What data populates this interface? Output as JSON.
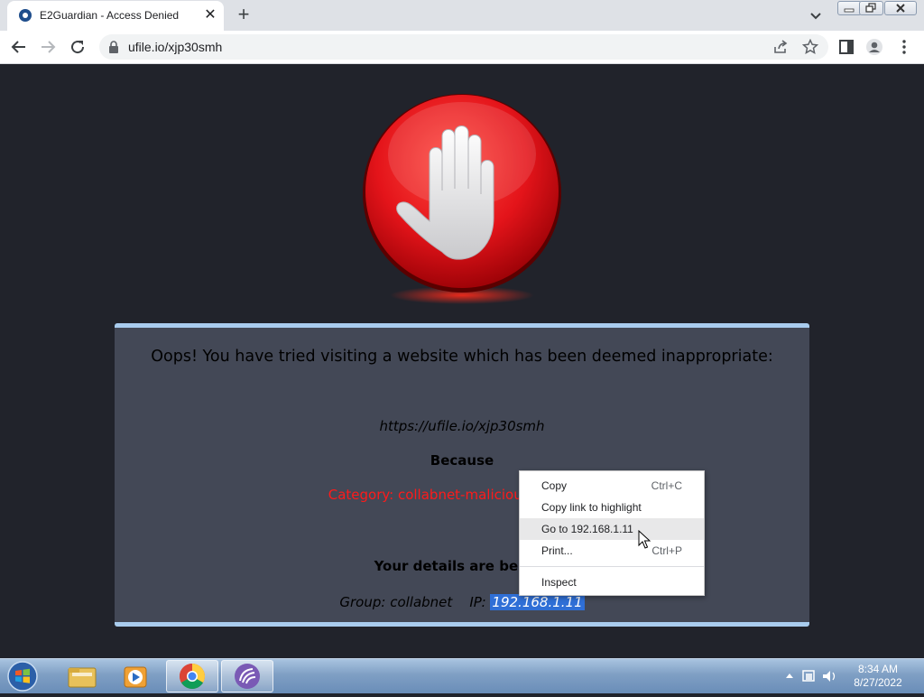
{
  "browser": {
    "tab_title": "E2Guardian - Access Denied",
    "url": "ufile.io/xjp30smh"
  },
  "page": {
    "heading": "Oops! You have tried visiting a website which has been deemed inappropriate:",
    "blocked_url": "https://ufile.io/xjp30smh",
    "because_label": "Because",
    "reason": "Category: collabnet-malicious - Blocked",
    "details_heading": "Your details are below:",
    "group_label": "Group:",
    "group_value": "collabnet",
    "ip_label": "IP:",
    "ip_value": "192.168.1.11"
  },
  "context_menu": {
    "items": [
      {
        "label": "Copy",
        "shortcut": "Ctrl+C"
      },
      {
        "label": "Copy link to highlight",
        "shortcut": ""
      },
      {
        "label": "Go to 192.168.1.11",
        "shortcut": ""
      },
      {
        "label": "Print...",
        "shortcut": "Ctrl+P"
      },
      {
        "label": "Inspect",
        "shortcut": ""
      }
    ]
  },
  "taskbar": {
    "time": "8:34 AM",
    "date": "8/27/2022"
  },
  "colors": {
    "page_background": "#21232b",
    "panel_background": "#434856",
    "panel_border": "#a9ccee",
    "reason_text": "#ff1a1a",
    "selection": "#2f6fd6"
  }
}
